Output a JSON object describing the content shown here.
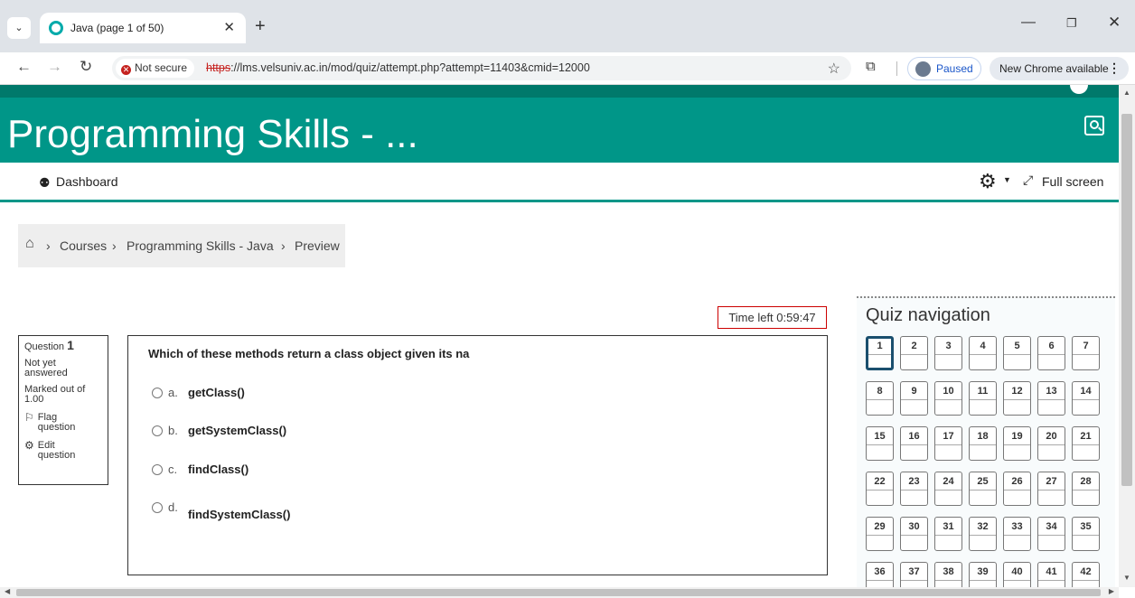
{
  "browser": {
    "tab_title": "Java (page 1 of 50)",
    "security_label": "Not secure",
    "url_scheme": "https",
    "url_rest": "://lms.velsuniv.ac.in/mod/quiz/attempt.php?attempt=11403&cmid=12000",
    "profile_status": "Paused",
    "update_label": "New Chrome available"
  },
  "site": {
    "title": "Programming Skills - ..."
  },
  "navbar": {
    "dashboard_label": "Dashboard",
    "fullscreen_label": "Full screen"
  },
  "breadcrumb": {
    "items": [
      "Courses",
      "Programming Skills - Java",
      "Preview"
    ]
  },
  "quiz": {
    "timer": "Time left 0:59:47",
    "info": {
      "question_label": "Question",
      "question_number": "1",
      "status": "Not yet answered",
      "marks": "Marked out of 1.00",
      "flag_label": "Flag question",
      "edit_label": "Edit question"
    },
    "question_text": "Which of these methods return a class object given its na",
    "options": [
      {
        "letter": "a.",
        "text": "getClass()"
      },
      {
        "letter": "b.",
        "text": "getSystemClass()"
      },
      {
        "letter": "c.",
        "text": "findClass()"
      },
      {
        "letter": "d.",
        "text": "findSystemClass()"
      }
    ]
  },
  "quiz_nav": {
    "title": "Quiz navigation",
    "current": 1,
    "buttons": [
      "1",
      "2",
      "3",
      "4",
      "5",
      "6",
      "7",
      "8",
      "9",
      "10",
      "11",
      "12",
      "13",
      "14",
      "15",
      "16",
      "17",
      "18",
      "19",
      "20",
      "21",
      "22",
      "23",
      "24",
      "25",
      "26",
      "27",
      "28",
      "29",
      "30",
      "31",
      "32",
      "33",
      "34",
      "35",
      "36",
      "37",
      "38",
      "39",
      "40",
      "41",
      "42"
    ]
  }
}
